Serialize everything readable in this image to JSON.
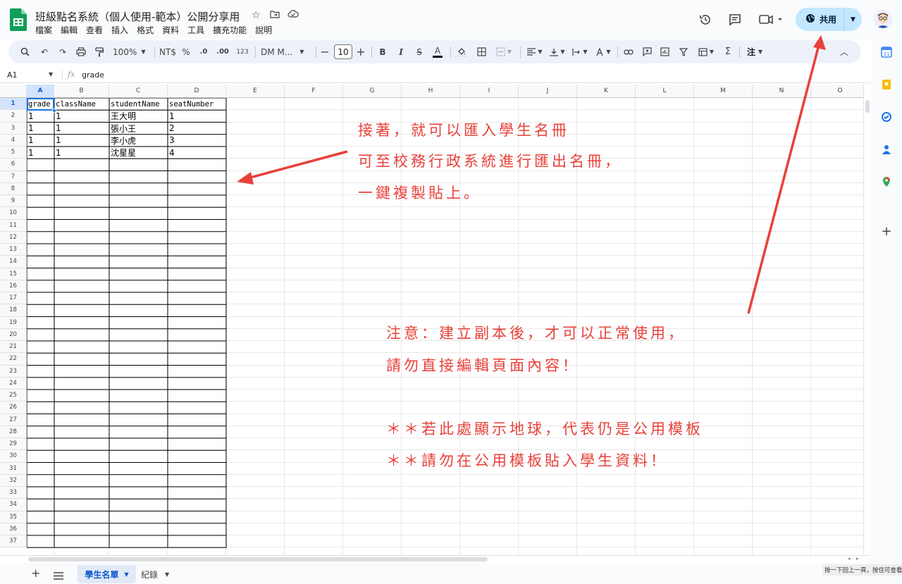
{
  "doc": {
    "title": "班級點名系統（個人使用-範本）公開分享用"
  },
  "menu": [
    "檔案",
    "編輯",
    "查看",
    "插入",
    "格式",
    "資料",
    "工具",
    "擴充功能",
    "說明"
  ],
  "share": {
    "label": "共用"
  },
  "toolbar": {
    "zoom": "100%",
    "currency": "NT$",
    "percent": "%",
    "dec_decrease": ".0",
    "dec_increase": ".00",
    "number_format": "123",
    "font": "DM M...",
    "font_size": "10",
    "bold": "B",
    "italic": "I",
    "strike": "S",
    "text_color": "A",
    "zh_note": "注"
  },
  "formula_bar": {
    "cell_ref": "A1",
    "fx": "fx",
    "value": "grade"
  },
  "columns": [
    "A",
    "B",
    "C",
    "D",
    "E",
    "F",
    "G",
    "H",
    "I",
    "J",
    "K",
    "L",
    "M",
    "N",
    "O"
  ],
  "rows": [
    "1",
    "2",
    "3",
    "4",
    "5",
    "6",
    "7",
    "8",
    "9",
    "10",
    "11",
    "12",
    "13",
    "14",
    "15",
    "16",
    "17",
    "18",
    "19",
    "20",
    "21",
    "22",
    "23",
    "24",
    "25",
    "26",
    "27",
    "28",
    "29",
    "30",
    "31",
    "32",
    "33",
    "34",
    "35",
    "36",
    "37"
  ],
  "sheet": {
    "headers": [
      "grade",
      "className",
      "studentName",
      "seatNumber"
    ],
    "data": [
      [
        "1",
        "1",
        "王大明",
        "1"
      ],
      [
        "1",
        "1",
        "張小王",
        "2"
      ],
      [
        "1",
        "1",
        "李小虎",
        "3"
      ],
      [
        "1",
        "1",
        "沈星星",
        "4"
      ]
    ]
  },
  "annotations": {
    "top_lines": [
      "接著，就可以匯入學生名冊",
      "可至校務行政系統進行匯出名冊，",
      "一鍵複製貼上。"
    ],
    "bottom_lines": [
      "注意：建立副本後，才可以正常使用，",
      "請勿直接編輯頁面內容！"
    ],
    "star_lines": [
      "＊＊若此處顯示地球，代表仍是公用模板",
      "＊＊請勿在公用模板貼入學生資料！"
    ],
    "color": "#e8413a"
  },
  "tabs": {
    "active": "學生名單",
    "other": "紀錄"
  },
  "status_hint": "按一下回上一頁，按住可查看",
  "colors": {
    "accent": "#0b57d0",
    "share_bg": "#c2e7ff",
    "sheets_green": "#0f9d58"
  }
}
